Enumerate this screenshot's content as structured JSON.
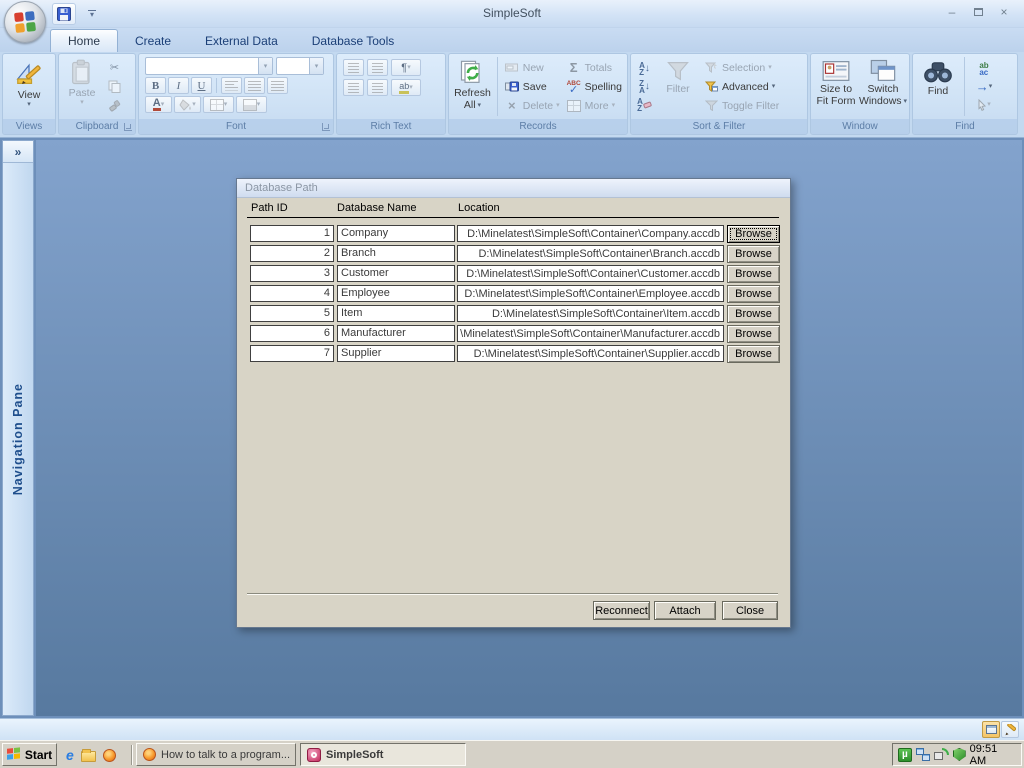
{
  "window": {
    "title": "SimpleSoft"
  },
  "tabs": [
    {
      "label": "Home"
    },
    {
      "label": "Create"
    },
    {
      "label": "External Data"
    },
    {
      "label": "Database Tools"
    }
  ],
  "ribbon": {
    "views": {
      "group_label": "Views",
      "view_label": "View"
    },
    "clipboard": {
      "group_label": "Clipboard",
      "paste_label": "Paste"
    },
    "font": {
      "group_label": "Font"
    },
    "rich_text": {
      "group_label": "Rich Text"
    },
    "records": {
      "group_label": "Records",
      "refresh_line1": "Refresh",
      "refresh_line2": "All",
      "new_label": "New",
      "save_label": "Save",
      "delete_label": "Delete",
      "totals_label": "Totals",
      "spelling_label": "Spelling",
      "more_label": "More"
    },
    "sort_filter": {
      "group_label": "Sort & Filter",
      "filter_label": "Filter",
      "selection_label": "Selection",
      "advanced_label": "Advanced",
      "toggle_label": "Toggle Filter"
    },
    "window_group": {
      "group_label": "Window",
      "size_line1": "Size to",
      "size_line2": "Fit Form",
      "switch_line1": "Switch",
      "switch_line2": "Windows"
    },
    "find_group": {
      "group_label": "Find",
      "find_label": "Find"
    }
  },
  "nav_pane": {
    "label": "Navigation Pane",
    "chevron": "»"
  },
  "dialog": {
    "title": "Database Path",
    "columns": {
      "id": "Path ID",
      "name": "Database Name",
      "location": "Location"
    },
    "browse_label": "Browse",
    "rows": [
      {
        "id": "1",
        "name": "Company",
        "location": "D:\\Minelatest\\SimpleSoft\\Container\\Company.accdb"
      },
      {
        "id": "2",
        "name": "Branch",
        "location": "D:\\Minelatest\\SimpleSoft\\Container\\Branch.accdb"
      },
      {
        "id": "3",
        "name": "Customer",
        "location": "D:\\Minelatest\\SimpleSoft\\Container\\Customer.accdb"
      },
      {
        "id": "4",
        "name": "Employee",
        "location": "D:\\Minelatest\\SimpleSoft\\Container\\Employee.accdb"
      },
      {
        "id": "5",
        "name": "Item",
        "location": "D:\\Minelatest\\SimpleSoft\\Container\\Item.accdb"
      },
      {
        "id": "6",
        "name": "Manufacturer",
        "location": "\\Minelatest\\SimpleSoft\\Container\\Manufacturer.accdb"
      },
      {
        "id": "7",
        "name": "Supplier",
        "location": "D:\\Minelatest\\SimpleSoft\\Container\\Supplier.accdb"
      }
    ],
    "buttons": {
      "reconnect": "Reconnect",
      "attach": "Attach",
      "close": "Close"
    }
  },
  "taskbar": {
    "start_label": "Start",
    "tasks": [
      {
        "label": "How to talk to a program..."
      },
      {
        "label": "SimpleSoft"
      }
    ],
    "clock": "09:51 AM"
  },
  "icons": {
    "chevron_small": "▾",
    "scissors": "✂",
    "bold": "B",
    "italic": "I",
    "underline": "U",
    "font_color": "A",
    "pilcrow": "¶",
    "totals": "Σ",
    "delete_x": "×",
    "check": "✓",
    "abc": "ABC",
    "goto_arrow": "→",
    "replace_ab": "ab",
    "replace_ac": "ac",
    "sort_a": "A",
    "sort_z": "Z",
    "arrow_down": "↓",
    "minimize": "–",
    "close_x": "×",
    "ie_e": "e",
    "mu": "µ",
    "highlight_ab": "ab"
  }
}
